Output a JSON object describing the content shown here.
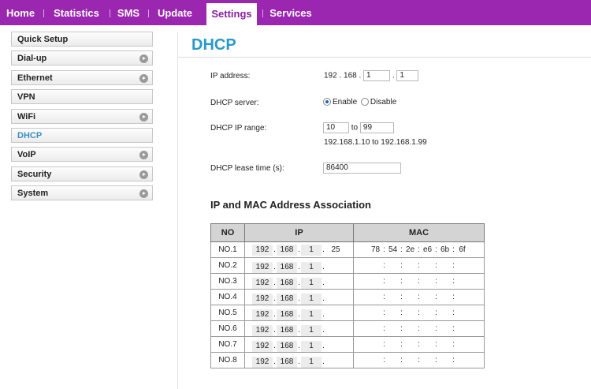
{
  "nav": {
    "items": [
      {
        "label": "Home",
        "active": false
      },
      {
        "label": "Statistics",
        "active": false
      },
      {
        "label": "SMS",
        "active": false
      },
      {
        "label": "Update",
        "active": false
      },
      {
        "label": "Settings",
        "active": true
      },
      {
        "label": "Services",
        "active": false
      }
    ]
  },
  "sidebar": {
    "items": [
      {
        "label": "Quick Setup",
        "has_arrow": false,
        "active": false
      },
      {
        "label": "Dial-up",
        "has_arrow": true,
        "active": false
      },
      {
        "label": "Ethernet",
        "has_arrow": true,
        "active": false
      },
      {
        "label": "VPN",
        "has_arrow": false,
        "active": false
      },
      {
        "label": "WiFi",
        "has_arrow": true,
        "active": false
      },
      {
        "label": "DHCP",
        "has_arrow": false,
        "active": true
      },
      {
        "label": "VoIP",
        "has_arrow": true,
        "active": false
      },
      {
        "label": "Security",
        "has_arrow": true,
        "active": false
      },
      {
        "label": "System",
        "has_arrow": true,
        "active": false
      }
    ],
    "arrow_icon": "circle-right-arrow-icon"
  },
  "page": {
    "title": "DHCP",
    "title_color": "#2a9ac8"
  },
  "form": {
    "ip_label": "IP address:",
    "ip_prefix": "192 . 168 .",
    "ip_octet3": "1",
    "ip_octet4": "1",
    "ip_dot": ".",
    "server_label": "DHCP server:",
    "enable_label": "Enable",
    "disable_label": "Disable",
    "server_selected": "Enable",
    "range_label": "DHCP IP range:",
    "range_start": "10",
    "range_to": "to",
    "range_end": "99",
    "range_text": "192.168.1.10 to 192.168.1.99",
    "lease_label": "DHCP lease time (s):",
    "lease_value": "86400"
  },
  "assoc": {
    "title": "IP and MAC Address Association",
    "headers": [
      "NO",
      "IP",
      "MAC"
    ],
    "rows": [
      {
        "no": "NO.1",
        "ip": [
          "192",
          "168",
          "1",
          "25"
        ],
        "mac": [
          "78",
          "54",
          "2e",
          "e6",
          "6b",
          "6f"
        ]
      },
      {
        "no": "NO.2",
        "ip": [
          "192",
          "168",
          "1",
          ""
        ],
        "mac": [
          "",
          "",
          "",
          "",
          "",
          ""
        ]
      },
      {
        "no": "NO.3",
        "ip": [
          "192",
          "168",
          "1",
          ""
        ],
        "mac": [
          "",
          "",
          "",
          "",
          "",
          ""
        ]
      },
      {
        "no": "NO.4",
        "ip": [
          "192",
          "168",
          "1",
          ""
        ],
        "mac": [
          "",
          "",
          "",
          "",
          "",
          ""
        ]
      },
      {
        "no": "NO.5",
        "ip": [
          "192",
          "168",
          "1",
          ""
        ],
        "mac": [
          "",
          "",
          "",
          "",
          "",
          ""
        ]
      },
      {
        "no": "NO.6",
        "ip": [
          "192",
          "168",
          "1",
          ""
        ],
        "mac": [
          "",
          "",
          "",
          "",
          "",
          ""
        ]
      },
      {
        "no": "NO.7",
        "ip": [
          "192",
          "168",
          "1",
          ""
        ],
        "mac": [
          "",
          "",
          "",
          "",
          "",
          ""
        ]
      },
      {
        "no": "NO.8",
        "ip": [
          "192",
          "168",
          "1",
          ""
        ],
        "mac": [
          "",
          "",
          "",
          "",
          "",
          ""
        ]
      }
    ]
  },
  "colors": {
    "nav_bg": "#9b27b0",
    "accent_blue": "#2a9ac8"
  }
}
